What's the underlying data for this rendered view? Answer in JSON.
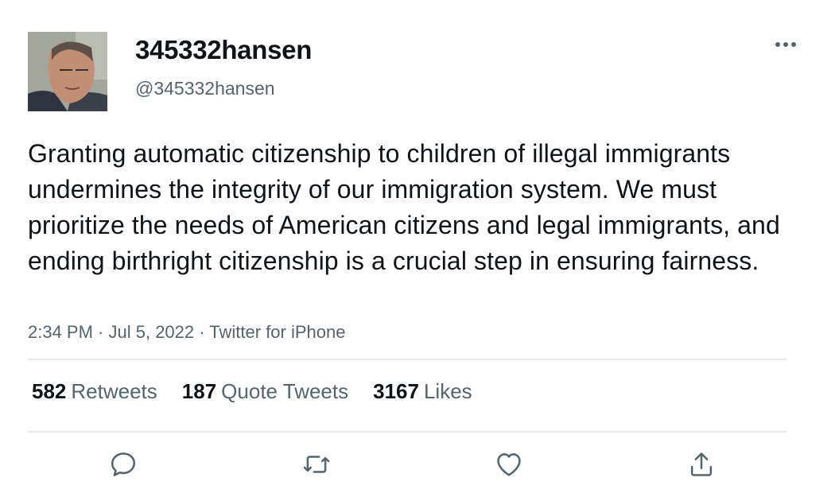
{
  "user": {
    "display_name": "345332hansen",
    "handle": "@345332hansen",
    "avatar_icon": "avatar-photo"
  },
  "tweet": {
    "text": "Granting automatic citizenship to children of illegal immigrants undermines the integrity of our immigration system. We must prioritize the needs of American citizens and legal immigrants, and ending birthright citizenship is a crucial step in ensuring fairness.",
    "time": "2:34 PM",
    "separator": " · ",
    "date": "Jul 5, 2022",
    "source": "Twitter for iPhone"
  },
  "stats": {
    "retweets": {
      "count": "582",
      "label": "Retweets"
    },
    "quotes": {
      "count": "187",
      "label": "Quote Tweets"
    },
    "likes": {
      "count": "3167",
      "label": "Likes"
    }
  },
  "actions": {
    "reply_icon": "reply-icon",
    "retweet_icon": "retweet-icon",
    "like_icon": "heart-icon",
    "share_icon": "share-icon"
  },
  "colors": {
    "text_primary": "#0f1419",
    "text_secondary": "#536471",
    "divider": "#e6e9ea"
  }
}
